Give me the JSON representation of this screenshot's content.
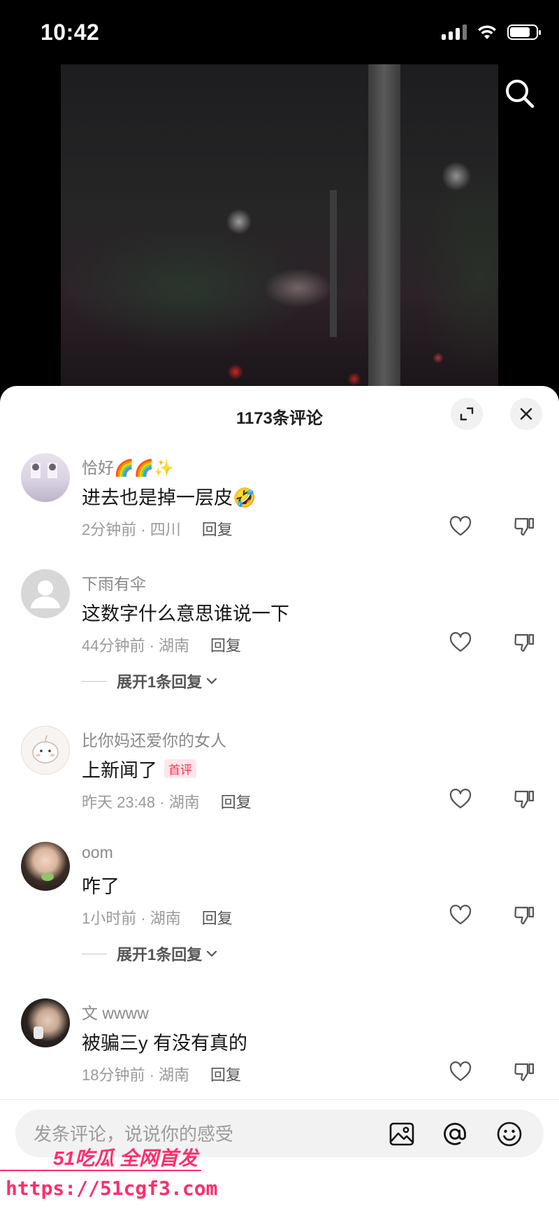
{
  "status_bar": {
    "time": "10:42",
    "battery_level": 0.78
  },
  "comments_panel": {
    "title": "1173条评论"
  },
  "comments": [
    {
      "name": "恰好🌈🌈✨",
      "text": "进去也是掉一层皮🤣",
      "meta": "2分钟前 · 四川",
      "reply_label": "回复"
    },
    {
      "name": "下雨有伞",
      "text": "这数字什么意思谁说一下",
      "meta": "44分钟前 · 湖南",
      "reply_label": "回复",
      "expand_label": "展开1条回复"
    },
    {
      "name": "比你妈还爱你的女人",
      "text": "上新闻了",
      "badge": "首评",
      "meta": "昨天 23:48 · 湖南",
      "reply_label": "回复"
    },
    {
      "name": "oom",
      "text": "咋了",
      "meta": "1小时前 · 湖南",
      "reply_label": "回复",
      "expand_label": "展开1条回复"
    },
    {
      "name": "文 wwww",
      "text": "被骗三y 有没有真的",
      "meta": "18分钟前 · 湖南",
      "reply_label": "回复"
    }
  ],
  "input": {
    "placeholder": "发条评论，说说你的感受"
  },
  "watermark": {
    "brand": "51吃瓜 全网首发",
    "url": "https://51cgf3.com"
  },
  "colors": {
    "accent": "#fe2c55",
    "watermark": "#ff2d6b"
  }
}
